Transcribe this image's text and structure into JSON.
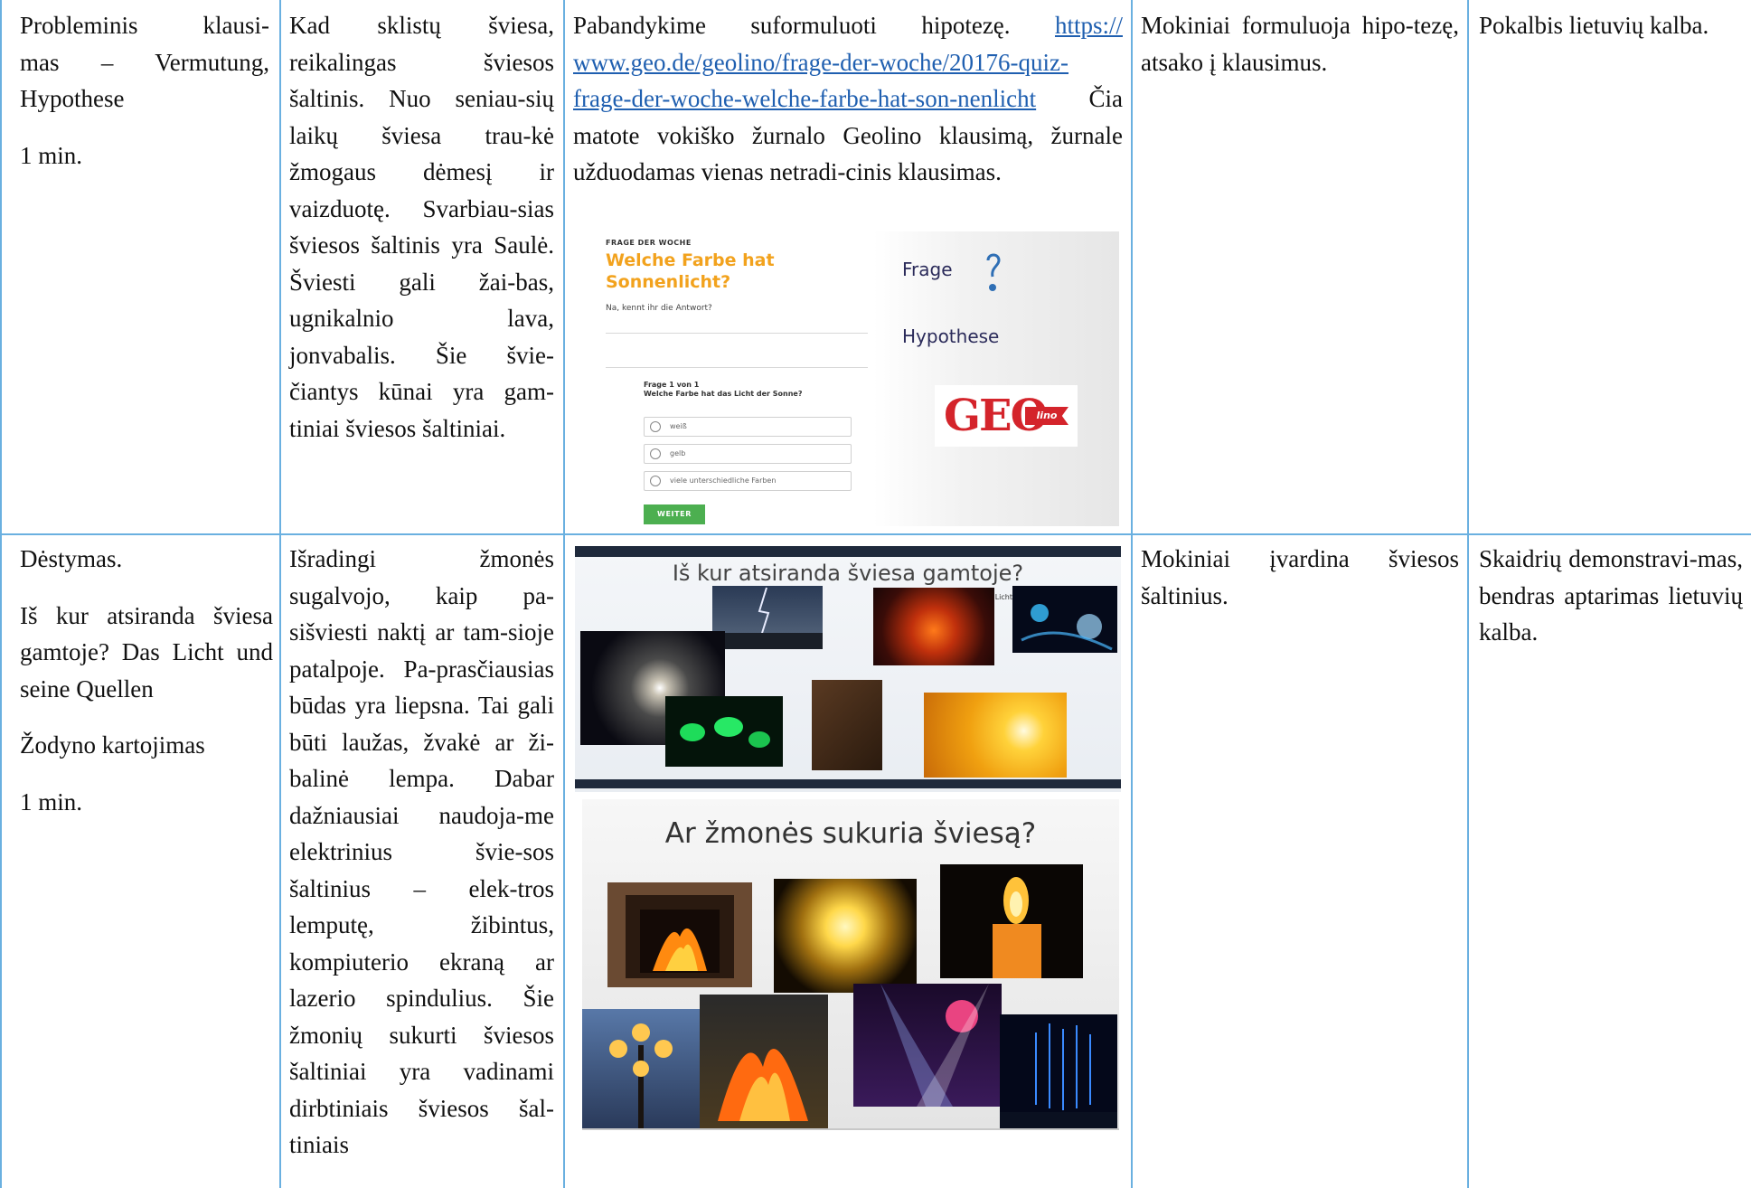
{
  "rows": [
    {
      "stage_lines": [
        "Probleminis klausi-",
        "mas – Vermutung,",
        "Hypothese"
      ],
      "stage_duration": "1 min.",
      "teacher_text": "Kad sklistų šviesa, reikalingas šviesos šaltinis. Nuo seniau-sių laikų šviesa trau-kė žmogaus dėmesį ir vaizduotę. Svarbiau-sias šviesos šaltinis yra Saulė. Šviesti gali žai-bas, ugnikalnio lava, jonvabalis. Šie švie-čiantys kūnai yra gam-tiniai šviesos šaltiniai.",
      "materials_intro": "Pabandykime suformuluoti hipotezę.",
      "materials_link": "https:// www.geo.de/geolino/frage-der-woche/20176-quiz-frage-der-woche-welche-farbe-hat-son-nenlicht",
      "materials_text": "Čia matote vokiško žurnalo Geolino klausimą, žurnale užduodamas vienas netradi-cinis klausimas.",
      "students": "Mokiniai formuluoja hipo-tezę, atsako į klausimus.",
      "method": "Pokalbis lietuvių kalba."
    },
    {
      "stage_lines": [
        "Dėstymas.",
        "Iš kur atsiranda šviesa gamtoje? Das Licht und seine Quellen",
        "Žodyno kartojimas",
        "1 min."
      ],
      "teacher_text": "Išradingi žmonės sugalvojo, kaip pa-sišviesti naktį ar tam-sioje patalpoje. Pa-prasčiausias būdas yra liepsna. Tai gali būti laužas, žvakė ar ži-balinė lempa. Dabar dažniausiai naudoja-me elektrinius švie-sos šaltinius – elek-tros lemputę, žibintus, kompiuterio ekraną ar lazerio spindulius. Šie žmonių sukurti šviesos šaltiniai yra vadinami dirbtiniais šviesos šal-tiniais",
      "students": "Mokiniai įvardina šviesos šaltinius.",
      "method": "Skaidrių demonstravi-mas, bendras aptarimas lietuvių kalba."
    }
  ],
  "slide_geolino": {
    "overline": "FRAGE DER WOCHE",
    "title": "Welche Farbe hat Sonnenlicht?",
    "subtitle": "Na, kennt ihr die Antwort?",
    "question_no": "Frage 1 von 1",
    "question": "Welche Farbe hat das Licht der Sonne?",
    "options": [
      "weiß",
      "gelb",
      "viele unterschiedliche Farben"
    ],
    "button": "WEITER",
    "label_frage": "Frage",
    "label_hypothese": "Hypothese",
    "logo_text": "GEO",
    "logo_tag": "lino",
    "colors": {
      "title": "#f2a21d",
      "button": "#4caf50",
      "logo": "#d4242b"
    }
  },
  "slide_nature": {
    "title": "Iš kur atsiranda šviesa gamtoje?",
    "subtitle": "Wie entsteht Licht in der Natur?"
  },
  "slide_human": {
    "title": "Ar žmonės sukuria šviesą?"
  },
  "border_color": "#6ab0e0",
  "link_color": "#1f5fb0"
}
